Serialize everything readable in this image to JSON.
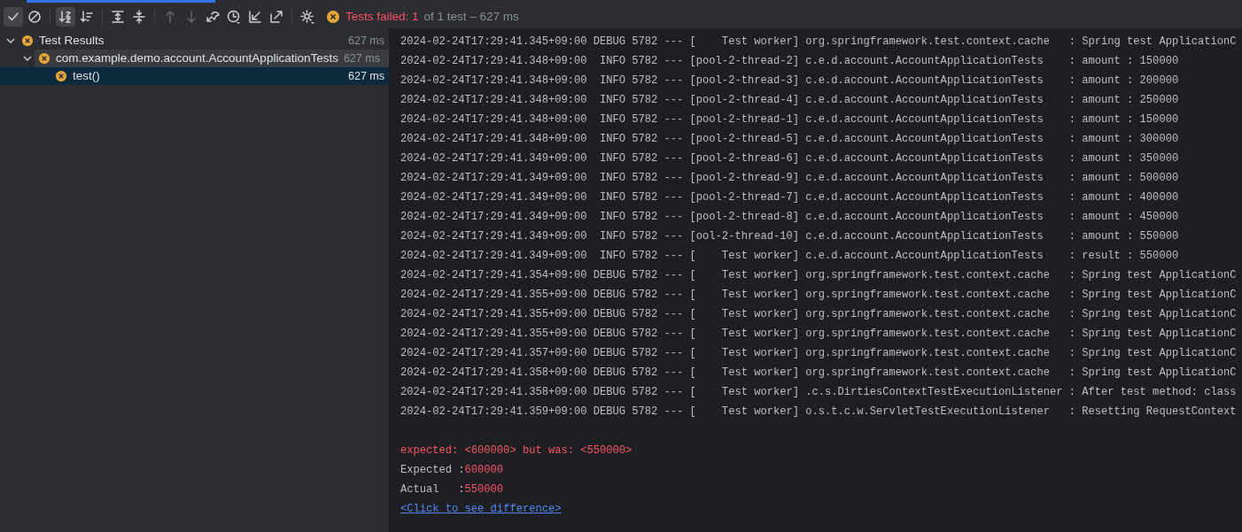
{
  "toolbar": {
    "buttons": [
      {
        "kind": "check",
        "on": true,
        "disabled": false
      },
      {
        "kind": "ignored",
        "on": false,
        "disabled": false
      },
      {
        "kind": "sep"
      },
      {
        "kind": "sort-alpha",
        "on": true,
        "disabled": false
      },
      {
        "kind": "sort-duration",
        "on": false,
        "disabled": false
      },
      {
        "kind": "sep"
      },
      {
        "kind": "expand-all",
        "on": false,
        "disabled": false
      },
      {
        "kind": "collapse-all",
        "on": false,
        "disabled": false
      },
      {
        "kind": "sep"
      },
      {
        "kind": "up",
        "on": false,
        "disabled": true
      },
      {
        "kind": "down",
        "on": false,
        "disabled": true
      },
      {
        "kind": "rerun",
        "on": false,
        "disabled": false
      },
      {
        "kind": "history",
        "on": false,
        "disabled": false
      },
      {
        "kind": "import",
        "on": false,
        "disabled": false
      },
      {
        "kind": "export",
        "on": false,
        "disabled": false
      },
      {
        "kind": "sep"
      },
      {
        "kind": "settings",
        "on": false,
        "disabled": false
      }
    ],
    "status": {
      "failed": "Tests failed: 1",
      "rest": "of 1 test – 627 ms"
    }
  },
  "tree": [
    {
      "label": "Test Results",
      "time": "627 ms",
      "expanded": true,
      "selected": false,
      "hovered": false,
      "children": [
        {
          "label": "com.example.demo.account.AccountApplicationTests",
          "time": "627 ms",
          "expanded": true,
          "selected": false,
          "hovered": true,
          "children": [
            {
              "label": "test()",
              "time": "627 ms",
              "selected": true,
              "hovered": false
            }
          ]
        }
      ]
    }
  ],
  "console": {
    "lines": [
      "2024-02-24T17:29:41.345+09:00 DEBUG 5782 --- [    Test worker] org.springframework.test.context.cache   : Spring test ApplicationC",
      "2024-02-24T17:29:41.348+09:00  INFO 5782 --- [pool-2-thread-2] c.e.d.account.AccountApplicationTests    : amount : 150000",
      "2024-02-24T17:29:41.348+09:00  INFO 5782 --- [pool-2-thread-3] c.e.d.account.AccountApplicationTests    : amount : 200000",
      "2024-02-24T17:29:41.348+09:00  INFO 5782 --- [pool-2-thread-4] c.e.d.account.AccountApplicationTests    : amount : 250000",
      "2024-02-24T17:29:41.348+09:00  INFO 5782 --- [pool-2-thread-1] c.e.d.account.AccountApplicationTests    : amount : 150000",
      "2024-02-24T17:29:41.348+09:00  INFO 5782 --- [pool-2-thread-5] c.e.d.account.AccountApplicationTests    : amount : 300000",
      "2024-02-24T17:29:41.349+09:00  INFO 5782 --- [pool-2-thread-6] c.e.d.account.AccountApplicationTests    : amount : 350000",
      "2024-02-24T17:29:41.349+09:00  INFO 5782 --- [pool-2-thread-9] c.e.d.account.AccountApplicationTests    : amount : 500000",
      "2024-02-24T17:29:41.349+09:00  INFO 5782 --- [pool-2-thread-7] c.e.d.account.AccountApplicationTests    : amount : 400000",
      "2024-02-24T17:29:41.349+09:00  INFO 5782 --- [pool-2-thread-8] c.e.d.account.AccountApplicationTests    : amount : 450000",
      "2024-02-24T17:29:41.349+09:00  INFO 5782 --- [ool-2-thread-10] c.e.d.account.AccountApplicationTests    : amount : 550000",
      "2024-02-24T17:29:41.349+09:00  INFO 5782 --- [    Test worker] c.e.d.account.AccountApplicationTests    : result : 550000",
      "2024-02-24T17:29:41.354+09:00 DEBUG 5782 --- [    Test worker] org.springframework.test.context.cache   : Spring test ApplicationC",
      "2024-02-24T17:29:41.355+09:00 DEBUG 5782 --- [    Test worker] org.springframework.test.context.cache   : Spring test ApplicationC",
      "2024-02-24T17:29:41.355+09:00 DEBUG 5782 --- [    Test worker] org.springframework.test.context.cache   : Spring test ApplicationC",
      "2024-02-24T17:29:41.355+09:00 DEBUG 5782 --- [    Test worker] org.springframework.test.context.cache   : Spring test ApplicationC",
      "2024-02-24T17:29:41.357+09:00 DEBUG 5782 --- [    Test worker] org.springframework.test.context.cache   : Spring test ApplicationC",
      "2024-02-24T17:29:41.358+09:00 DEBUG 5782 --- [    Test worker] org.springframework.test.context.cache   : Spring test ApplicationC",
      "2024-02-24T17:29:41.358+09:00 DEBUG 5782 --- [    Test worker] .c.s.DirtiesContextTestExecutionListener : After test method: class",
      "2024-02-24T17:29:41.359+09:00 DEBUG 5782 --- [    Test worker] o.s.t.c.w.ServletTestExecutionListener   : Resetting RequestContext"
    ],
    "failure": {
      "message": "expected: <600000> but was: <550000>",
      "expected": {
        "label": "Expected :",
        "value": "600000"
      },
      "actual": {
        "label": "Actual   :",
        "value": "550000"
      },
      "link": "<Click to see difference>"
    }
  }
}
